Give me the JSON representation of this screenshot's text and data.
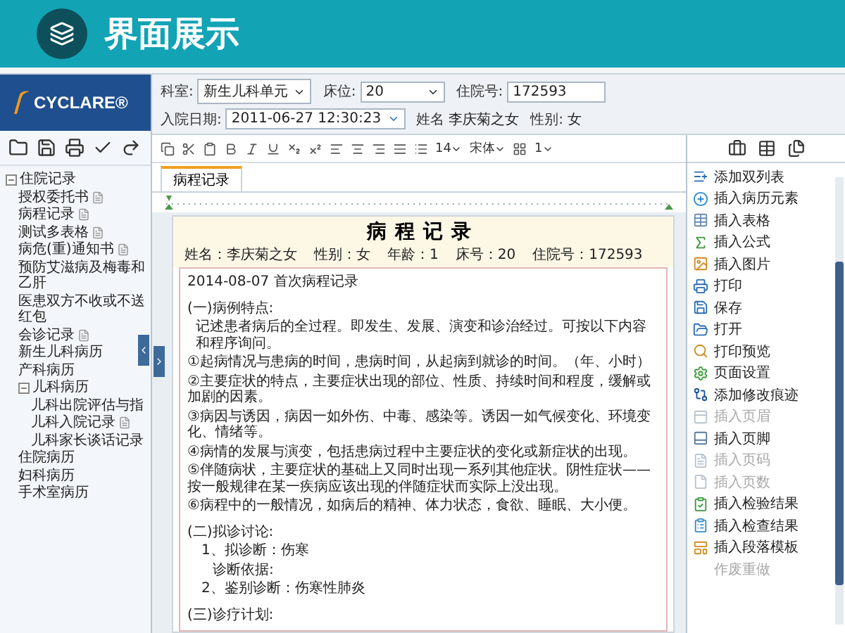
{
  "slide": {
    "title": "界面展示"
  },
  "logo": {
    "text": "CYCLARE®"
  },
  "patient_bar": [
    {
      "label": "科室:",
      "value": "新生儿科单元",
      "kind": "select"
    },
    {
      "label": "床位:",
      "value": "20",
      "kind": "select"
    },
    {
      "label": "住院号:",
      "value": "172593",
      "kind": "input"
    },
    {
      "label": "入院日期:",
      "value": "2011-06-27 12:30:23",
      "kind": "date"
    },
    {
      "label": "姓名",
      "value": "李庆菊之女",
      "kind": "text"
    },
    {
      "label": "性别:",
      "value": "女",
      "kind": "text"
    }
  ],
  "tree": [
    {
      "label": "住院记录",
      "expanded": true,
      "children": [
        {
          "label": "授权委托书",
          "file": true
        },
        {
          "label": "病程记录",
          "file": true
        },
        {
          "label": "测试多表格",
          "file": true
        },
        {
          "label": "病危(重)通知书",
          "file": true
        },
        {
          "label": "预防艾滋病及梅毒和乙肝",
          "file": false
        },
        {
          "label": "医患双方不收或不送红包",
          "file": false
        },
        {
          "label": "会诊记录",
          "file": true
        },
        {
          "label": "新生儿科病历",
          "file": false
        },
        {
          "label": "产科病历",
          "file": false
        },
        {
          "label": "儿科病历",
          "expanded": true,
          "children": [
            {
              "label": "儿科出院评估与指",
              "file": false
            },
            {
              "label": "儿科入院记录",
              "file": true
            },
            {
              "label": "儿科家长谈话记录",
              "file": false
            }
          ]
        },
        {
          "label": "住院病历",
          "file": false
        },
        {
          "label": "妇科病历",
          "file": false
        },
        {
          "label": "手术室病历",
          "file": false
        }
      ]
    }
  ],
  "editor_toolbar": {
    "font_size": "14",
    "font": "宋体",
    "columns": "1"
  },
  "tabs": [
    {
      "label": "病程记录",
      "selected": true
    }
  ],
  "document": {
    "title": "病程记录",
    "patient": [
      "姓名：李庆菊之女",
      "性别：女",
      "年龄：1",
      "床号：20",
      "住院号：172593"
    ],
    "paragraphs": [
      {
        "text": "2014-08-07 首次病程记录",
        "kind": "line"
      },
      {
        "text": "(一)病例特点:",
        "kind": "heading"
      },
      {
        "text": "记述患者病后的全过程。即发生、发展、演变和诊治经过。可按以下内容和程序询问。",
        "kind": "indent"
      },
      {
        "text": "①起病情况与患病的时间，患病时间，从起病到就诊的时间。（年、小时）",
        "kind": "line"
      },
      {
        "text": "②主要症状的特点，主要症状出现的部位、性质、持续时间和程度，缓解或加剧的因素。",
        "kind": "line"
      },
      {
        "text": "③病因与诱因，病因一如外伤、中毒、感染等。诱因一如气候变化、环境变化、情绪等。",
        "kind": "line"
      },
      {
        "text": "④病情的发展与演变，包括患病过程中主要症状的变化或新症状的出现。",
        "kind": "line"
      },
      {
        "text": "⑤伴随病状，主要症状的基础上又同时出现一系列其他症状。阴性症状——按一般规律在某一疾病应该出现的伴随症状而实际上没出现。",
        "kind": "line"
      },
      {
        "text": "⑥病程中的一般情况，如病后的精神、体力状态，食欲、睡眠、大小便。",
        "kind": "line"
      },
      {
        "text": "(二)拟诊讨论:",
        "kind": "heading"
      },
      {
        "text": "1、拟诊断：伤寒",
        "kind": "sub"
      },
      {
        "text": "诊断依据:",
        "kind": "sub2"
      },
      {
        "text": "2、鉴别诊断：伤寒性肺炎",
        "kind": "sub"
      },
      {
        "text": "(三)诊疗计划:",
        "kind": "heading"
      }
    ]
  },
  "actions": [
    {
      "label": "添加双列表",
      "disabled": false
    },
    {
      "label": "插入病历元素",
      "disabled": false
    },
    {
      "label": "插入表格",
      "disabled": false
    },
    {
      "label": "插入公式",
      "disabled": false
    },
    {
      "label": "插入图片",
      "disabled": false
    },
    {
      "label": "打印",
      "disabled": false
    },
    {
      "label": "保存",
      "disabled": false
    },
    {
      "label": "打开",
      "disabled": false
    },
    {
      "label": "打印预览",
      "disabled": false
    },
    {
      "label": "页面设置",
      "disabled": false
    },
    {
      "label": "添加修改痕迹",
      "disabled": false
    },
    {
      "label": "插入页眉",
      "disabled": true
    },
    {
      "label": "插入页脚",
      "disabled": false
    },
    {
      "label": "插入页码",
      "disabled": true
    },
    {
      "label": "插入页数",
      "disabled": true
    },
    {
      "label": "插入检验结果",
      "disabled": false
    },
    {
      "label": "插入检查结果",
      "disabled": false
    },
    {
      "label": "插入段落模板",
      "disabled": false
    },
    {
      "label": "作废重做",
      "disabled": true
    }
  ]
}
